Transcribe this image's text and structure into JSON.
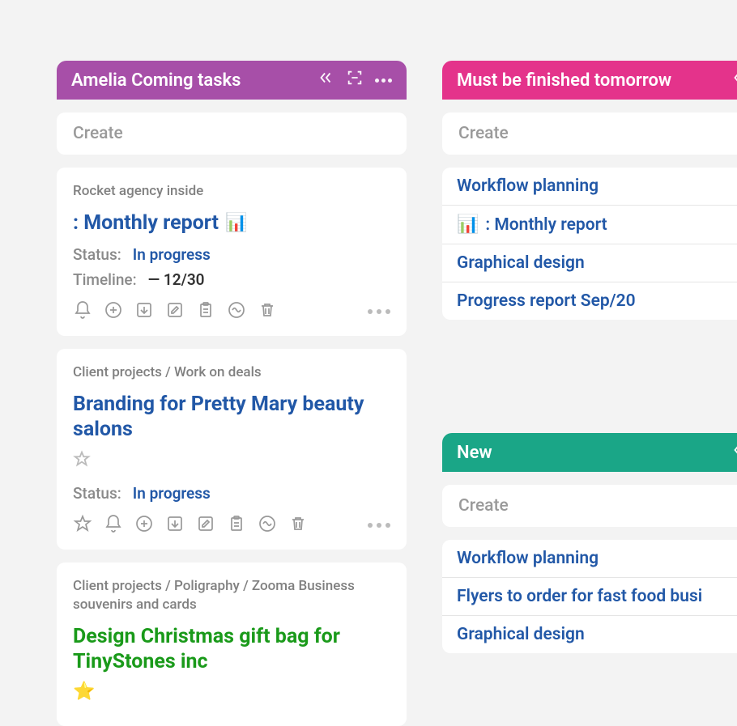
{
  "left_column": {
    "title": "Amelia Coming tasks",
    "create_label": "Create",
    "cards": [
      {
        "breadcrumb": "Rocket agency inside",
        "title": ": Monthly report",
        "title_icon": "chart",
        "status_label": "Status:",
        "status_value": "In progress",
        "timeline_label": "Timeline:",
        "timeline_value": "— 12/30",
        "actions": [
          "bell",
          "plus",
          "import",
          "edit",
          "clipboard",
          "wave",
          "trash"
        ]
      },
      {
        "breadcrumb": "Client projects / Work on deals",
        "title": "Branding for Pretty Mary beauty salons",
        "title_icon": "star-outline",
        "status_label": "Status:",
        "status_value": "In progress",
        "actions": [
          "star",
          "bell",
          "plus",
          "import",
          "edit",
          "clipboard",
          "wave",
          "trash"
        ]
      },
      {
        "breadcrumb": "Client projects / Poligraphy / Zooma Business souvenirs and cards",
        "title": "Design Christmas gift bag for TinyStones inc",
        "title_icon": "star-filled",
        "title_color": "green"
      }
    ]
  },
  "right_column": {
    "sections": [
      {
        "title": "Must be finished tomorrow",
        "header_color": "pink",
        "create_label": "Create",
        "rows": [
          {
            "label": "Workflow planning"
          },
          {
            "label": ": Monthly report",
            "icon": "chart"
          },
          {
            "label": "Graphical design"
          },
          {
            "label": "Progress report Sep/20"
          }
        ]
      },
      {
        "title": "New",
        "header_color": "teal",
        "create_label": "Create",
        "rows": [
          {
            "label": "Workflow planning"
          },
          {
            "label": "Flyers to order for fast food busi"
          },
          {
            "label": "Graphical design"
          }
        ]
      }
    ]
  }
}
